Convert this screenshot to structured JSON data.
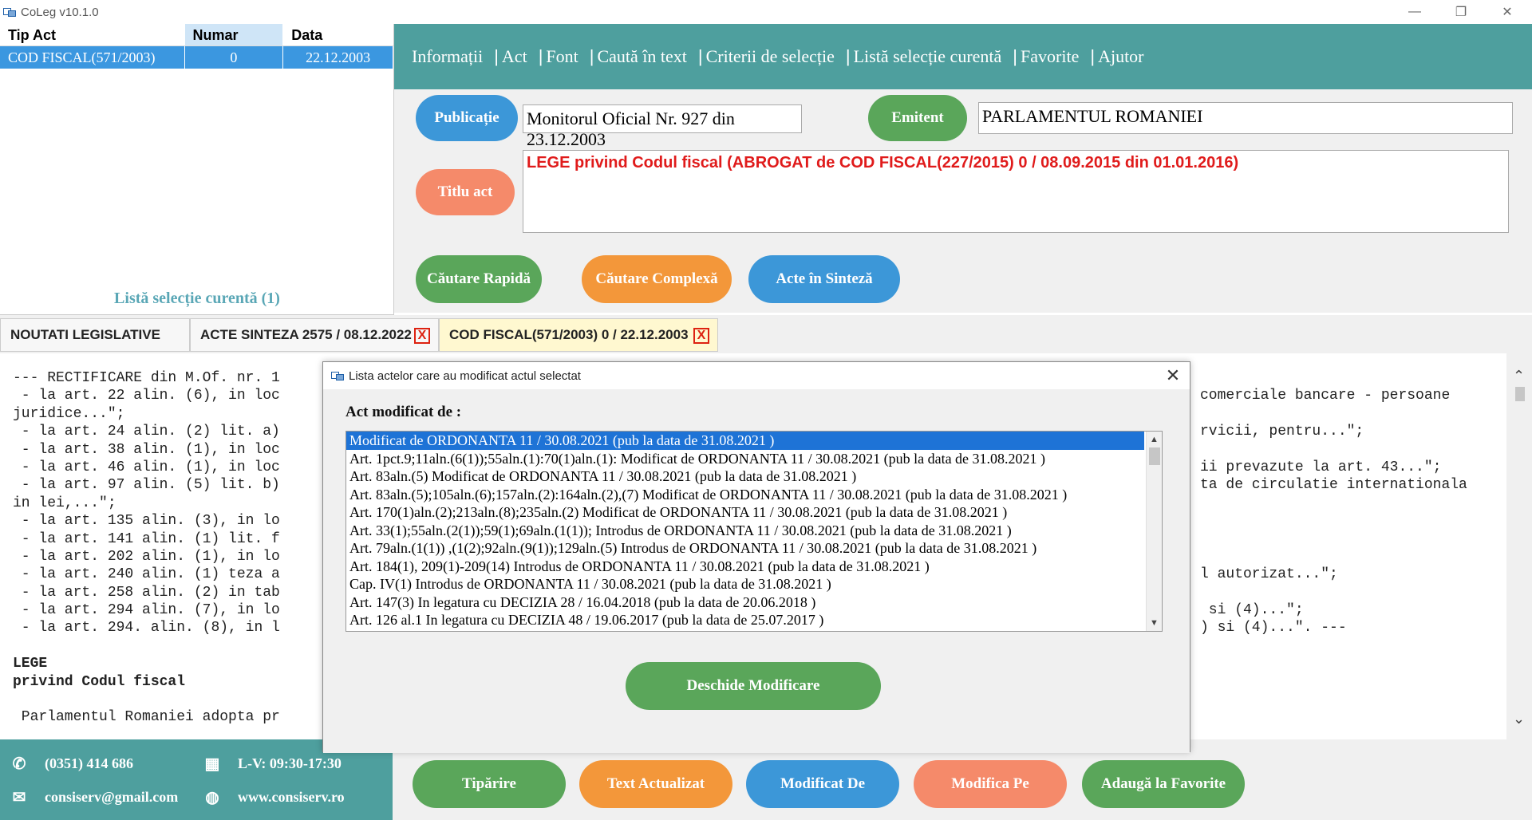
{
  "window": {
    "title": "CoLeg v10.1.0",
    "controls": [
      "—",
      "❐",
      "✕"
    ]
  },
  "left_list": {
    "columns": [
      "Tip Act",
      "Numar",
      "Data"
    ],
    "rows": [
      {
        "tip": "COD FISCAL(571/2003)",
        "numar": "0",
        "data": "22.12.2003"
      }
    ],
    "footer": "Listă selecție curentă (1)"
  },
  "menu": [
    "Informații",
    "Act",
    "Font",
    "Caută în text",
    "Criterii de selecție",
    "Listă selecție curentă",
    "Favorite",
    "Ajutor"
  ],
  "form": {
    "publicatie_label": "Publicație",
    "publicatie_value": "Monitorul Oficial Nr. 927 din 23.12.2003",
    "emitent_label": "Emitent",
    "emitent_value": "PARLAMENTUL ROMANIEI",
    "titlu_label": "Titlu act",
    "titlu_value": "LEGE privind Codul fiscal (ABROGAT de COD FISCAL(227/2015) 0 / 08.09.2015 din 01.01.2016)",
    "cautare_rapida": "Căutare Rapidă",
    "cautare_complexa": "Căutare Complexă",
    "acte_sinteza": "Acte în Sinteză"
  },
  "tabs": [
    {
      "label": "NOUTATI LEGISLATIVE"
    },
    {
      "label": "ACTE SINTEZA 2575 / 08.12.2022",
      "close": "X"
    },
    {
      "label": "COD FISCAL(571/2003) 0 / 22.12.2003",
      "close": "X"
    }
  ],
  "content_left": [
    "--- RECTIFICARE din M.Of. nr. 1",
    " - la art. 22 alin. (6), in loc",
    "juridice...\";",
    " - la art. 24 alin. (2) lit. a)",
    " - la art. 38 alin. (1), in loc",
    " - la art. 46 alin. (1), in loc",
    " - la art. 97 alin. (5) lit. b)",
    "in lei,...\";",
    " - la art. 135 alin. (3), in lo",
    " - la art. 141 alin. (1) lit. f",
    " - la art. 202 alin. (1), in lo",
    " - la art. 240 alin. (1) teza a",
    " - la art. 258 alin. (2) in tab",
    " - la art. 294 alin. (7), in lo",
    " - la art. 294. alin. (8), in l",
    "",
    "LEGE",
    "privind Codul fiscal",
    "",
    " Parlamentul Romaniei adopta pr"
  ],
  "content_right": [
    "",
    "comerciale bancare - persoane",
    "",
    "rvicii, pentru...\";",
    "",
    "ii prevazute la art. 43...\";",
    "ta de circulatie internationala",
    "",
    "",
    "",
    "",
    "l autorizat...\";",
    "",
    " si (4)...\";",
    ") si (4)...\". ---"
  ],
  "footer": {
    "phone": "(0351) 414 686",
    "hours": "L-V: 09:30-17:30",
    "email": "consiserv@gmail.com",
    "website": "www.consiserv.ro",
    "buttons": [
      "Tipărire",
      "Text Actualizat",
      "Modificat De",
      "Modifica Pe",
      "Adaugă la Favorite"
    ]
  },
  "modal": {
    "title": "Lista actelor care au modificat actul selectat",
    "label": "Act modificat de :",
    "items": [
      "Modificat de ORDONANTA 11 / 30.08.2021  (pub la data de 31.08.2021 )",
      "Art. 1pct.9;11aln.(6(1));55aln.(1):70(1)aln.(1): Modificat de ORDONANTA 11 / 30.08.2021  (pub la data de 31.08.2021 )",
      "Art. 83aln.(5) Modificat de ORDONANTA 11 / 30.08.2021  (pub la data de 31.08.2021 )",
      "Art. 83aln.(5);105aln.(6);157aln.(2):164aln.(2),(7) Modificat de ORDONANTA 11 / 30.08.2021  (pub la data de 31.08.2021 )",
      "Art. 170(1)aln.(2);213aln.(8);235aln.(2) Modificat de ORDONANTA 11 / 30.08.2021  (pub la data de 31.08.2021 )",
      "Art. 33(1);55aln.(2(1));59(1);69aln.(1(1)); Introdus de ORDONANTA 11 / 30.08.2021  (pub la data de 31.08.2021 )",
      "Art. 79aln.(1(1)) ,(1(2);92aln.(9(1));129aln.(5) Introdus de ORDONANTA 11 / 30.08.2021  (pub la data de 31.08.2021 )",
      "Art. 184(1), 209(1)-209(14) Introdus de ORDONANTA 11 / 30.08.2021  (pub la data de 31.08.2021 )",
      "Cap. IV(1) Introdus de ORDONANTA 11 / 30.08.2021  (pub la data de 31.08.2021 )",
      "Art. 147(3) In legatura cu DECIZIA 28 / 16.04.2018  (pub la data de 20.06.2018 )",
      "Art. 126 al.1 In legatura cu DECIZIA 48 / 19.06.2017  (pub la data de 25.07.2017 )"
    ],
    "open_button": "Deschide Modificare",
    "close": "✕"
  },
  "colors": {
    "teal": "#4e9f9e",
    "blue": "#3c97d8",
    "green": "#5aa65a",
    "orange": "#f3973a",
    "salmon": "#f58a6a",
    "title_red": "#e01b1b",
    "selection_blue": "#1e73d6"
  },
  "icons": {
    "phone": "phone-icon",
    "calculator": "calculator-icon",
    "email": "envelope-icon",
    "web": "globe-icon"
  }
}
